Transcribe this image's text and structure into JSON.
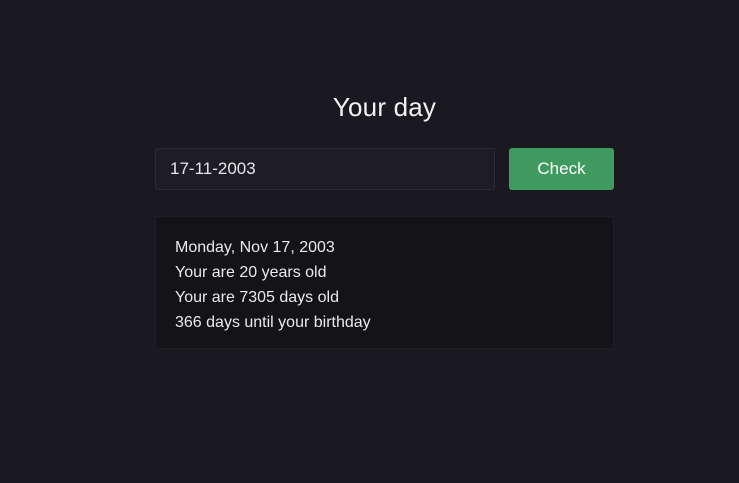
{
  "header": {
    "title": "Your day"
  },
  "form": {
    "date_value": "17-11-2003",
    "check_label": "Check"
  },
  "result": {
    "lines": [
      "Monday, Nov 17, 2003",
      "Your are 20 years old",
      "Your are 7305 days old",
      "366 days until your birthday"
    ]
  },
  "colors": {
    "background": "#1a1920",
    "button": "#3f9a5f",
    "card": "#141318"
  }
}
